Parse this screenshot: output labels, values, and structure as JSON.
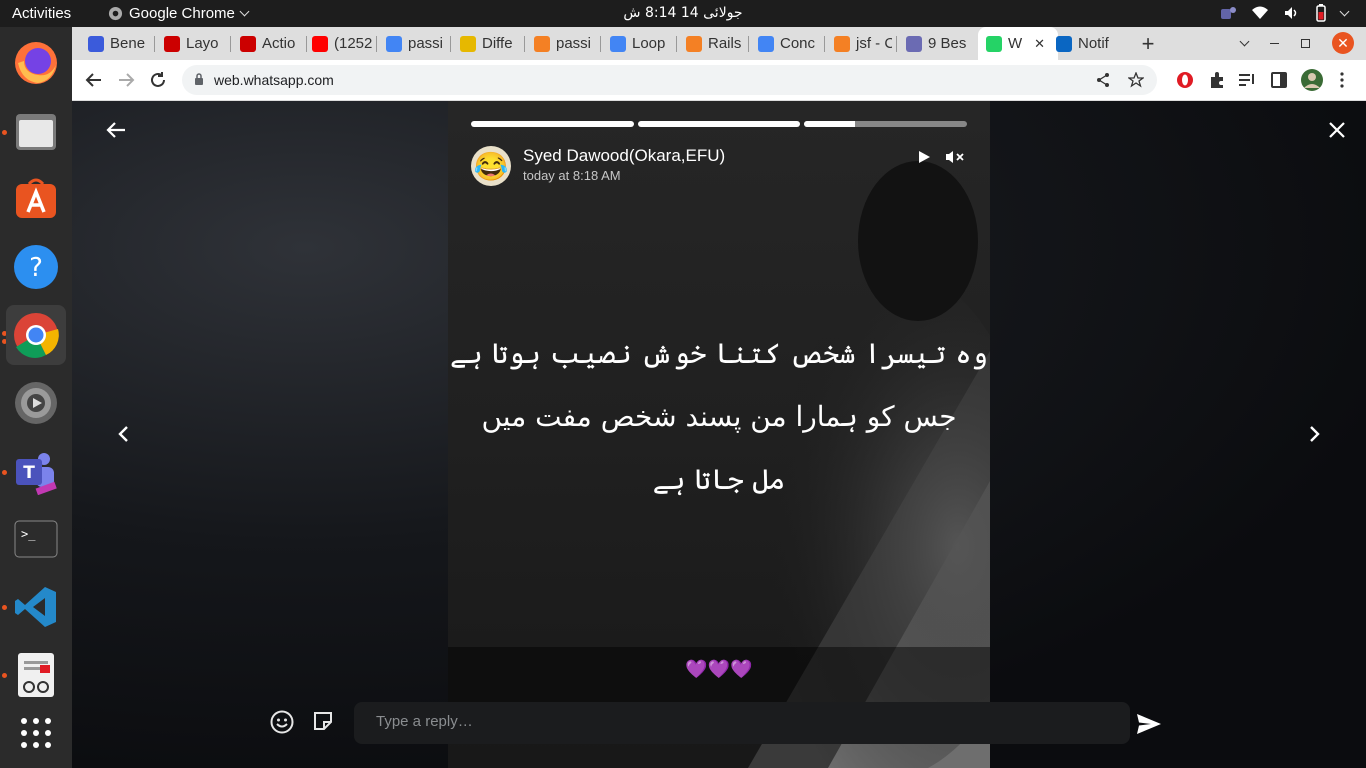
{
  "topbar": {
    "activities": "Activities",
    "app_name": "Google Chrome",
    "clock": "جولائی 14  8:14 ش"
  },
  "dock": {
    "items": [
      "firefox-icon",
      "files-icon",
      "software-icon",
      "help-icon",
      "chrome-icon",
      "settings-icon",
      "teams-icon",
      "terminal-icon",
      "vscode-icon",
      "document-viewer-icon",
      "app-grid-icon"
    ]
  },
  "tabs": [
    {
      "label": "Bene",
      "icon": "bene-icon",
      "color": "#3b5bdb"
    },
    {
      "label": "Layo",
      "icon": "rails-guides-icon",
      "color": "#c00"
    },
    {
      "label": "Actio",
      "icon": "rails-guides-icon",
      "color": "#c00"
    },
    {
      "label": "(1252",
      "icon": "youtube-icon",
      "color": "#f00"
    },
    {
      "label": "passi",
      "icon": "google-icon",
      "color": "#4285f4"
    },
    {
      "label": "Diffe",
      "icon": "tab-icon",
      "color": "#e6b800"
    },
    {
      "label": "passi",
      "icon": "stackoverflow-icon",
      "color": "#f48024"
    },
    {
      "label": "Loop",
      "icon": "google-icon",
      "color": "#4285f4"
    },
    {
      "label": "Rails",
      "icon": "stackoverflow-icon",
      "color": "#f48024"
    },
    {
      "label": "Conc",
      "icon": "google-icon",
      "color": "#4285f4"
    },
    {
      "label": "jsf - C",
      "icon": "stackoverflow-icon",
      "color": "#f48024"
    },
    {
      "label": "9 Bes",
      "icon": "tab-icon",
      "color": "#6b6bb3"
    },
    {
      "label": "W",
      "icon": "whatsapp-icon",
      "color": "#25d366"
    },
    {
      "label": "Notif",
      "icon": "linkedin-icon",
      "color": "#0a66c2"
    }
  ],
  "address": {
    "url": "web.whatsapp.com"
  },
  "story": {
    "progress": [
      1.0,
      1.0,
      0.31
    ],
    "author": "Syed Dawood(Okara,EFU)",
    "time": "today at 8:18 AM",
    "avatar_emoji": "😂",
    "poem_lines": [
      "وہ تیسرا شخص کتنا خوش نصیب ہوتا ہے",
      "جس کو ہمارا من پسند شخص مفت میں",
      "مل جاتا ہے"
    ],
    "caption": "💜💜💜",
    "reply_placeholder": "Type a reply…"
  },
  "colors": {
    "accent": "#e95420",
    "story_bg": "#202020",
    "backdrop": "#0c0d10"
  }
}
